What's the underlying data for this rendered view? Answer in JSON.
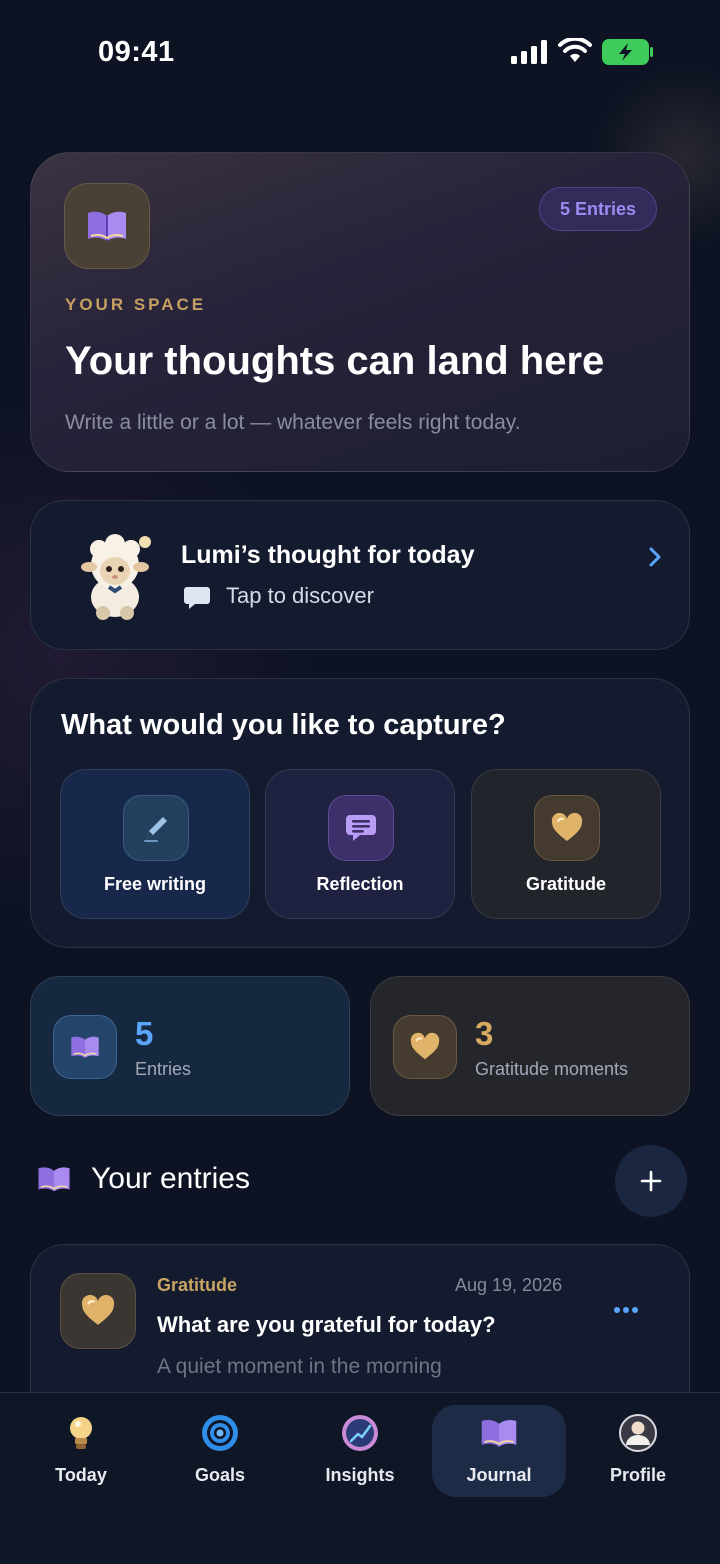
{
  "status_bar": {
    "time": "09:41"
  },
  "hero": {
    "entries_badge": "5 Entries",
    "eyebrow": "YOUR SPACE",
    "title": "Your thoughts can land here",
    "subtitle": "Write a little or a lot — whatever feels right today."
  },
  "lumi": {
    "title": "Lumi’s thought for today",
    "subtitle": "Tap to discover"
  },
  "capture": {
    "title": "What would you like to capture?",
    "options": [
      {
        "label": "Free writing",
        "icon": "pen-icon"
      },
      {
        "label": "Reflection",
        "icon": "speech-bubble-icon"
      },
      {
        "label": "Gratitude",
        "icon": "heart-icon"
      }
    ]
  },
  "stats": {
    "entries": {
      "value": "5",
      "label": "Entries"
    },
    "gratitude": {
      "value": "3",
      "label": "Gratitude moments"
    }
  },
  "entries_section": {
    "title": "Your entries",
    "items": [
      {
        "category": "Gratitude",
        "date": "Aug 19, 2026",
        "title": "What are you grateful for today?",
        "preview": "A quiet moment in the morning"
      }
    ]
  },
  "nav": {
    "items": [
      {
        "label": "Today",
        "icon": "lightbulb-icon"
      },
      {
        "label": "Goals",
        "icon": "target-icon"
      },
      {
        "label": "Insights",
        "icon": "chart-icon"
      },
      {
        "label": "Journal",
        "icon": "book-icon"
      },
      {
        "label": "Profile",
        "icon": "person-icon"
      }
    ],
    "active": "Journal"
  },
  "colors": {
    "background": "#0d1322",
    "accent_blue": "#5aa6ff",
    "accent_gold": "#c9a364",
    "accent_purple": "#9b8cf2"
  }
}
